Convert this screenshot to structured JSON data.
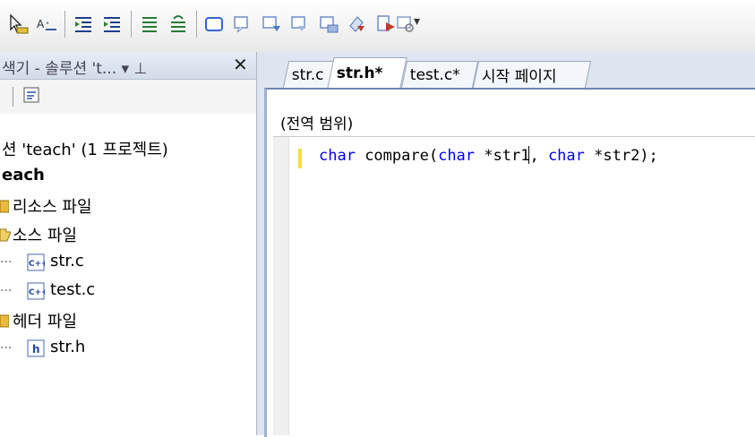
{
  "toolbar": {
    "items": [
      {
        "name": "pointer-select-icon"
      },
      {
        "name": "font-size-icon",
        "glyph": "A⇟"
      },
      {
        "name": "outdent-icon"
      },
      {
        "name": "indent-icon"
      },
      {
        "name": "comment-lines-icon"
      },
      {
        "name": "uncomment-lines-icon"
      },
      {
        "name": "window-icon"
      },
      {
        "name": "toggle-bookmark-icon"
      },
      {
        "name": "next-bookmark-icon"
      },
      {
        "name": "prev-bookmark-icon"
      },
      {
        "name": "bookmark-folder-icon"
      },
      {
        "name": "clear-bookmarks-icon"
      },
      {
        "name": "export-bookmark-icon"
      },
      {
        "name": "find-icon"
      }
    ]
  },
  "solution_explorer": {
    "title": "색기 - 솔루션 't... ▾  ⊥",
    "tree": [
      {
        "label": "션 'teach' (1 프로젝트)",
        "bold": false,
        "icon": "none"
      },
      {
        "label": "each",
        "bold": true,
        "icon": "none"
      },
      {
        "label": "리소스 파일",
        "bold": false,
        "icon": "folder-closed-icon"
      },
      {
        "label": "소스 파일",
        "bold": false,
        "icon": "folder-open-icon"
      },
      {
        "label": "str.c",
        "bold": false,
        "icon": "cpp-file-icon",
        "child": true
      },
      {
        "label": "test.c",
        "bold": false,
        "icon": "cpp-file-icon",
        "child": true
      },
      {
        "label": "헤더 파일",
        "bold": false,
        "icon": "folder-closed-icon"
      },
      {
        "label": "str.h",
        "bold": false,
        "icon": "header-file-icon",
        "child": true
      }
    ]
  },
  "editor": {
    "tabs": [
      {
        "label": "str.c",
        "active": false
      },
      {
        "label": "str.h*",
        "active": true
      },
      {
        "label": "test.c*",
        "active": false
      },
      {
        "label": "시작 페이지",
        "active": false
      }
    ],
    "scope": "(전역 범위)",
    "code": {
      "kw1": "char",
      "mid1": " compare(",
      "kw2": "char",
      "mid2": " *str1",
      "mid3": ", ",
      "kw3": "char",
      "end": " *str2);"
    }
  },
  "colors": {
    "keyword": "#0000ff",
    "change_marker": "#f2df3f",
    "tab_border": "#9aa6b8"
  }
}
